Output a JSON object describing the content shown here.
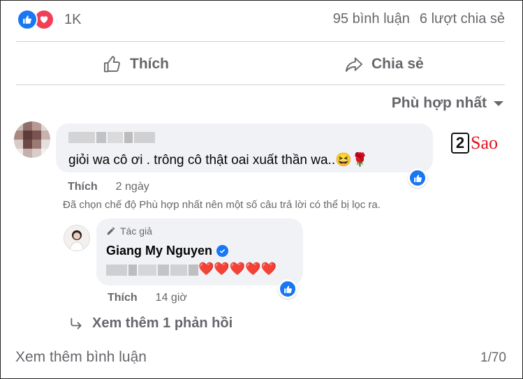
{
  "reactions": {
    "count": "1K",
    "icons": [
      "like-icon",
      "love-icon"
    ],
    "like_color": "#1877f2",
    "love_color": "#f33e58"
  },
  "stats": {
    "comments": "95 bình luận",
    "shares": "6 lượt chia sẻ"
  },
  "actions": {
    "like_label": "Thích",
    "share_label": "Chia sẻ"
  },
  "sort": {
    "label": "Phù hợp nhất"
  },
  "comment": {
    "text": "giỏi wa cô ơi . trông cô thật oai xuất thần wa..😆🌹",
    "like_label": "Thích",
    "time": "2 ngày"
  },
  "filter_note": "Đã chọn chế độ Phù hợp nhất nên một số câu trả lời có thể bị lọc ra.",
  "reply": {
    "author_badge": "Tác giả",
    "name": "Giang My Nguyen",
    "hearts": "❤️❤️❤️❤️❤️",
    "like_label": "Thích",
    "time": "14 giờ"
  },
  "view_more_replies": "Xem thêm 1 phản hồi",
  "view_more_comments": "Xem thêm bình luận",
  "pagination": "1/70",
  "watermark": {
    "number": "2",
    "text": "Sao"
  }
}
